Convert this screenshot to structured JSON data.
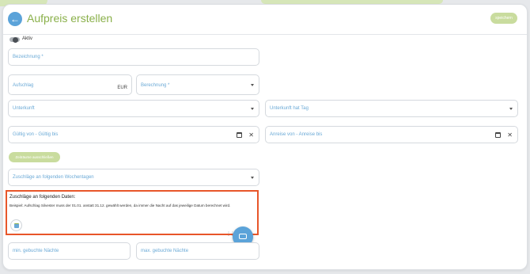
{
  "header": {
    "back_icon": "arrow-left-icon",
    "title": "Aufpreis erstellen",
    "save_label": "speichern"
  },
  "toggle": {
    "label": "Aktiv",
    "checked": false
  },
  "fields": {
    "bezeichnung": "Bezeichnung *",
    "aufschlag": "Aufschlag",
    "aufschlag_suffix": "EUR",
    "berechnung": "Berechnung *",
    "unterkunft": "Unterkunft",
    "unterkunft_tag": "Unterkunft hat Tag",
    "gueltig": "Gültig von - Gültig bis",
    "anreise": "Anreise von - Anreise bis",
    "zeitraeume_button": "Zeiträume ausschließen",
    "wochentage": "Zuschläge an folgenden Wochentagen",
    "min_naechte": "min. gebuchte Nächte",
    "max_naechte": "max. gebuchte Nächte"
  },
  "daten_section": {
    "title": "Zuschläge an folgenden Daten:",
    "note": "Beispiel: Aufschlag Silvester muss der 01.01. anstatt 31.12. gewählt werden, da immer die Nacht auf das jeweilige Datum berechnet wird."
  },
  "icons": {
    "calendar": "calendar-icon",
    "clear": "close-icon",
    "chat": "chat-icon",
    "caret": "chevron-down-icon"
  },
  "colors": {
    "accent_green": "#8ab04a",
    "button_green": "#c9dc9e",
    "label_blue": "#6aa9d6",
    "primary_blue": "#5ba3d9",
    "highlight_orange": "#e8562a"
  }
}
